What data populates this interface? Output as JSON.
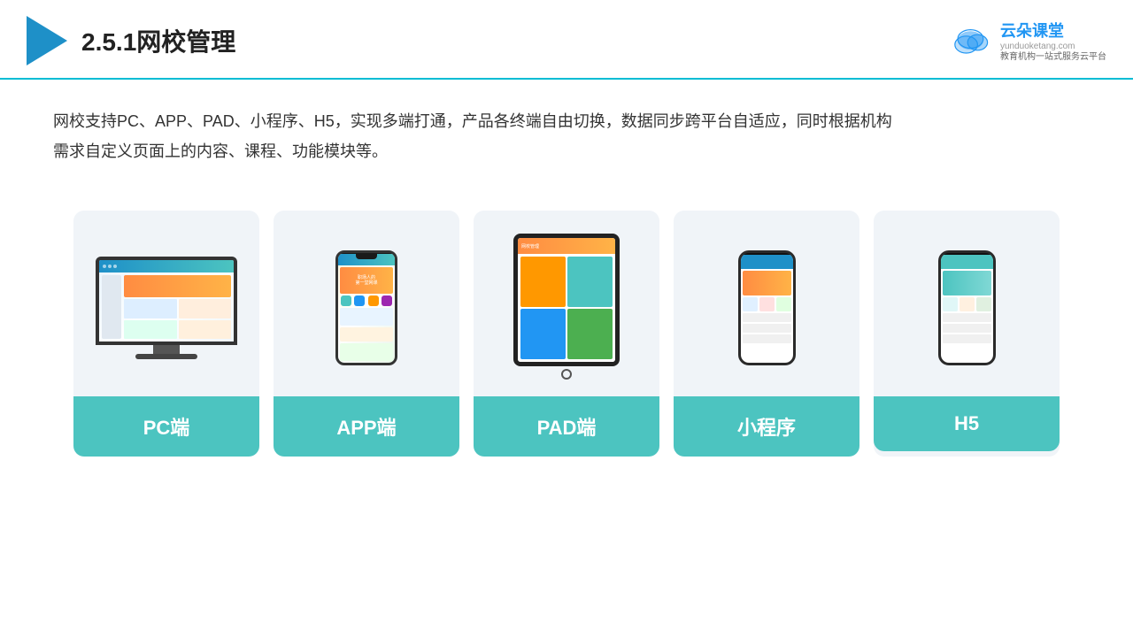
{
  "header": {
    "title": "2.5.1网校管理",
    "title_number": "2.5.1",
    "title_main": "网校管理"
  },
  "brand": {
    "name": "云朵课堂",
    "url": "yunduoketang.com",
    "tagline": "教育机构一站\n式服务云平台"
  },
  "description": {
    "text": "网校支持PC、APP、PAD、小程序、H5，实现多端打通，产品各终端自由切换，数据同步跨平台自适应，同时根据机构\n需求自定义页面上的内容、课程、功能模块等。"
  },
  "cards": [
    {
      "id": "pc",
      "label": "PC端",
      "device_type": "pc"
    },
    {
      "id": "app",
      "label": "APP端",
      "device_type": "phone"
    },
    {
      "id": "pad",
      "label": "PAD端",
      "device_type": "tablet"
    },
    {
      "id": "mini",
      "label": "小程序",
      "device_type": "mini"
    },
    {
      "id": "h5",
      "label": "H5",
      "device_type": "h5"
    }
  ],
  "colors": {
    "teal": "#4cc4c0",
    "blue": "#1e90c8",
    "accent_orange": "#ff8c42",
    "bg_card": "#f0f4f8",
    "text_dark": "#333333",
    "header_border": "#00bcd4"
  }
}
